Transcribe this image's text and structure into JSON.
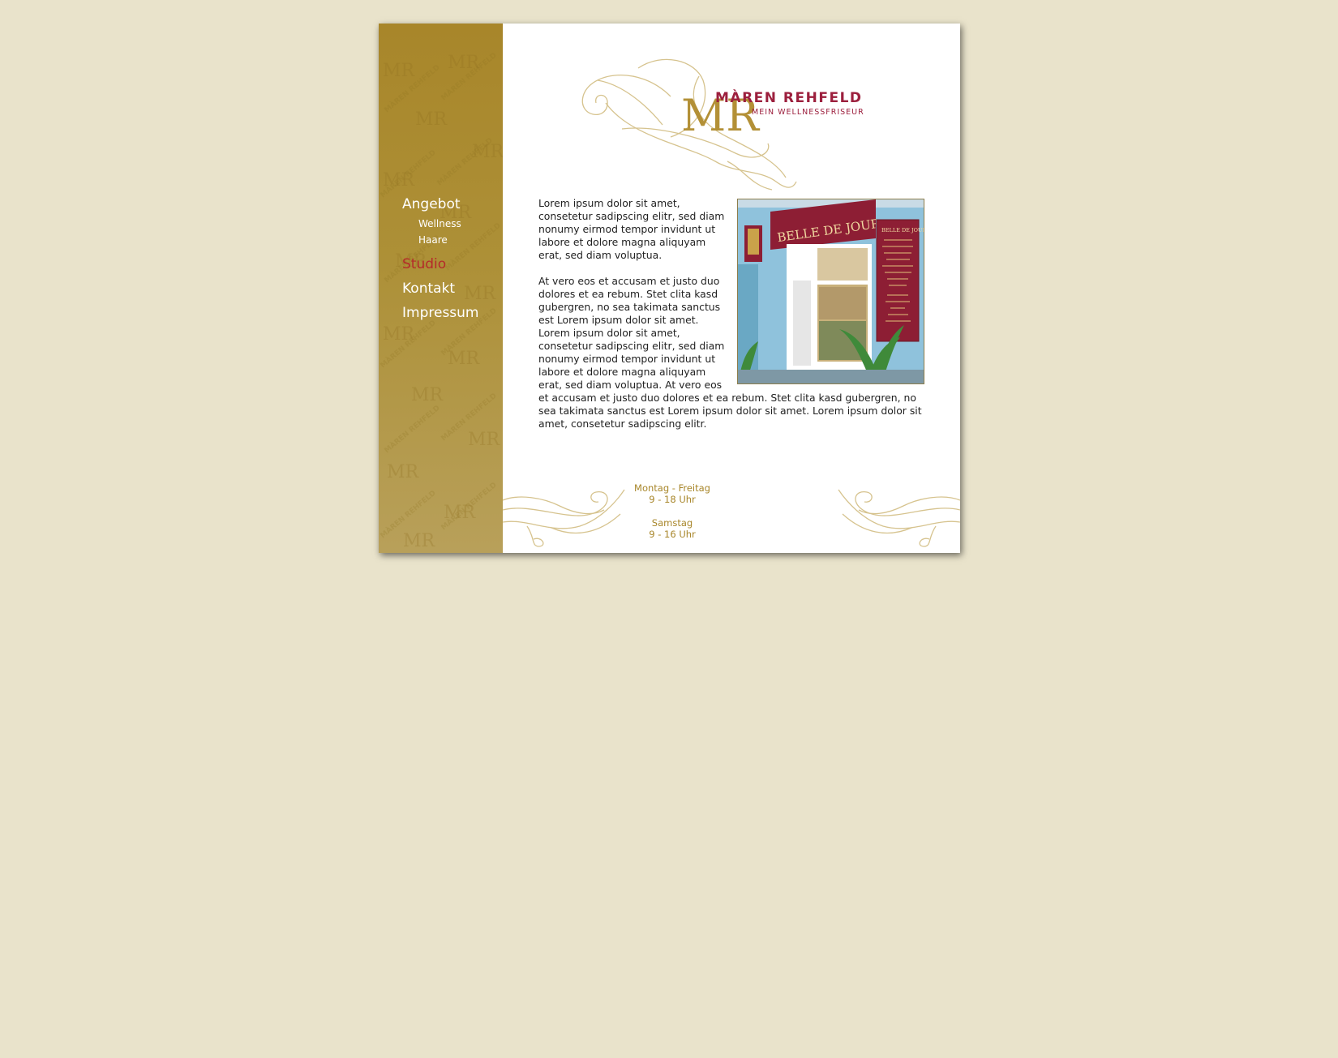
{
  "brand": {
    "monogram": "MR",
    "name": "MÀREN REHFELD",
    "tagline": "MEIN WELLNESSFRISEUR",
    "watermark_text": "MÀREN REHFELD"
  },
  "nav": {
    "items": [
      {
        "label": "Angebot",
        "active": false
      },
      {
        "label": "Studio",
        "active": true
      },
      {
        "label": "Kontakt",
        "active": false
      },
      {
        "label": "Impressum",
        "active": false
      }
    ],
    "subitems": [
      {
        "label": "Wellness"
      },
      {
        "label": "Haare"
      }
    ]
  },
  "content": {
    "paragraph1": "Lorem ipsum dolor sit amet, consetetur sadipscing elitr, sed diam nonumy eirmod tempor invidunt ut labore et dolore magna aliquyam erat, sed diam voluptua.",
    "paragraph2": "At vero eos et accusam et justo duo dolores et ea rebum. Stet clita kasd gubergren, no sea takimata sanctus est Lorem ipsum dolor sit amet. Lorem ipsum dolor sit amet, consetetur sadipscing elitr, sed diam nonumy eirmod tempor invidunt ut labore et dolore magna aliquyam erat, sed diam voluptua. At vero eos et accusam et justo duo dolores et ea rebum. Stet clita kasd gubergren, no sea takimata sanctus est Lorem ipsum dolor sit amet. Lorem ipsum dolor sit amet, consetetur sadipscing elitr."
  },
  "photo": {
    "shop_sign": "BELLE DE JOUR",
    "board_title": "BELLE DE JOUR"
  },
  "hours": {
    "weekday_label": "Montag - Freitag",
    "weekday_time": "9 - 18 Uhr",
    "saturday_label": "Samstag",
    "saturday_time": "9 - 16 Uhr"
  },
  "colors": {
    "background": "#e9e3cb",
    "sidebar_gold": "#a8862a",
    "brand_red": "#9c1f3d",
    "active_nav": "#b52a2a",
    "hours_gold": "#a8862a"
  }
}
